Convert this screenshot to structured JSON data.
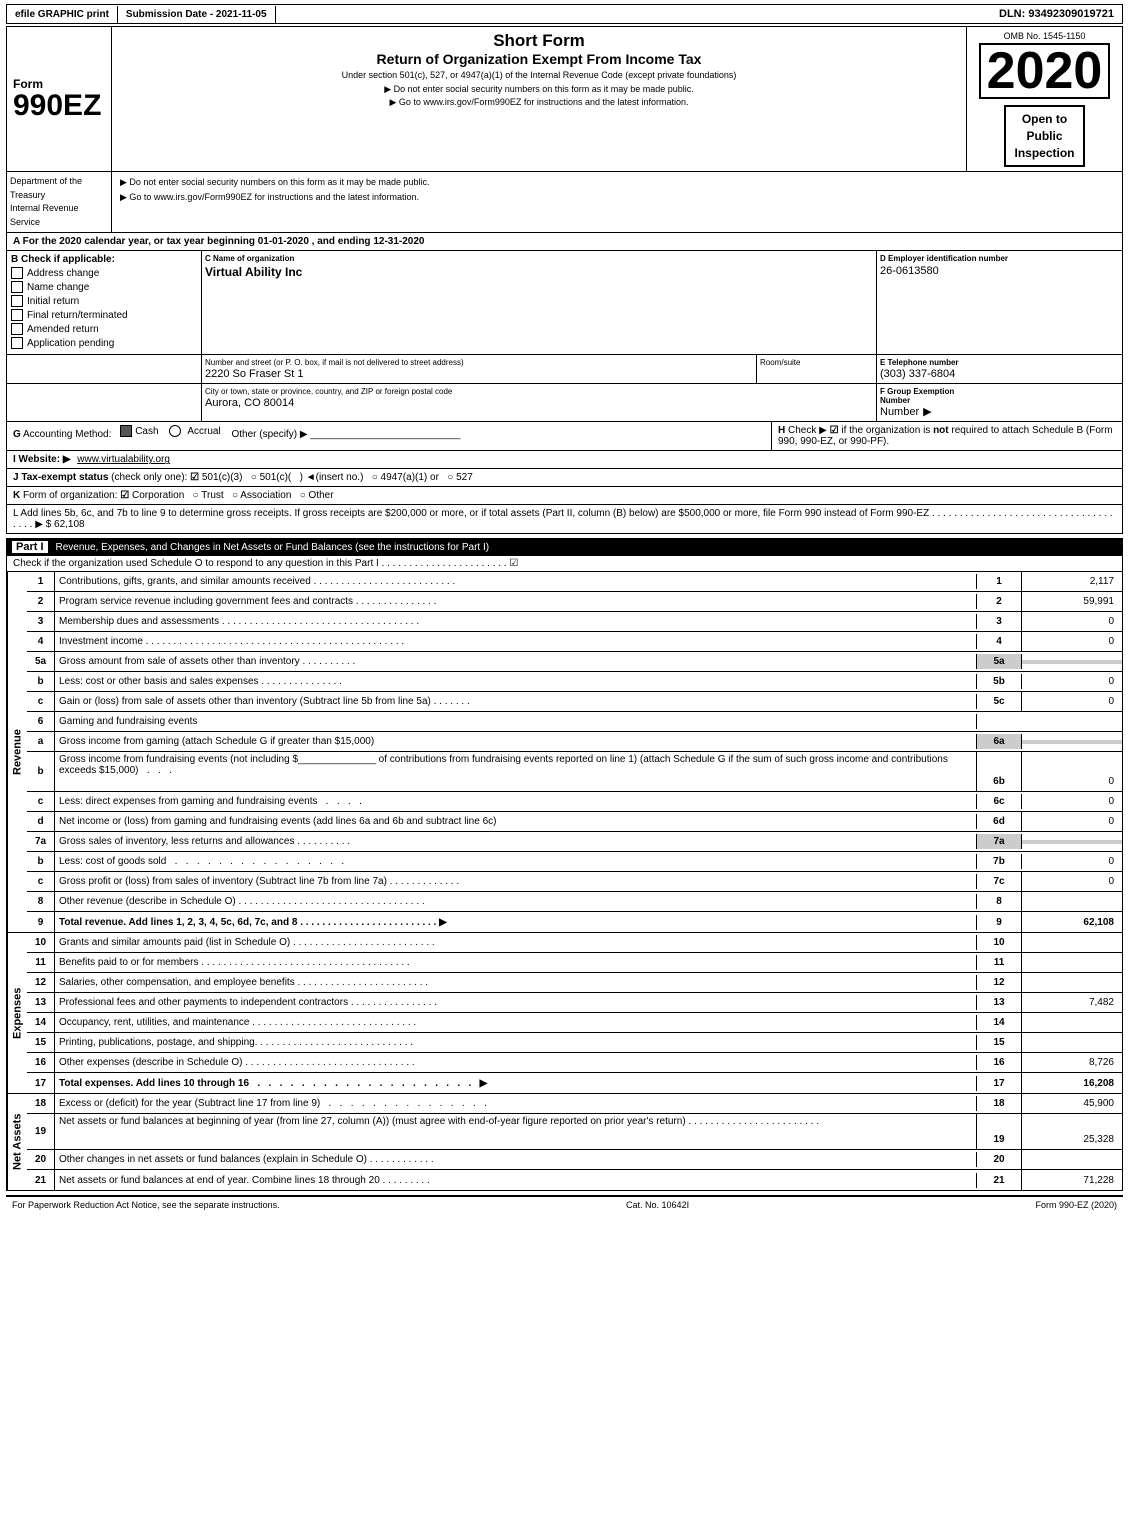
{
  "header": {
    "efile_label": "efile GRAPHIC print",
    "submission_label": "Submission Date - 2021-11-05",
    "dln_label": "DLN: 93492309019721",
    "form_number": "990EZ",
    "short_form": "Short Form",
    "return_title": "Return of Organization Exempt From Income Tax",
    "under_section": "Under section 501(c), 527, or 4947(a)(1) of the Internal Revenue Code (except private foundations)",
    "ssn_warning": "▶ Do not enter social security numbers on this form as it may be made public.",
    "goto_text": "▶ Go to www.irs.gov/Form990EZ for instructions and the latest information.",
    "year": "2020",
    "omb": "OMB No. 1545-1150",
    "open_to_public": "Open to\nPublic\nInspection",
    "dept_line1": "Department of the",
    "dept_line2": "Treasury",
    "dept_line3": "Internal Revenue",
    "dept_line4": "Service"
  },
  "section_a": {
    "text": "A For the 2020 calendar year, or tax year beginning 01-01-2020 , and ending 12-31-2020"
  },
  "check_applicable": {
    "label": "B Check if applicable:",
    "items": [
      {
        "id": "address_change",
        "label": "Address change",
        "checked": false
      },
      {
        "id": "name_change",
        "label": "Name change",
        "checked": false
      },
      {
        "id": "initial_return",
        "label": "Initial return",
        "checked": false
      },
      {
        "id": "final_return",
        "label": "Final return/terminated",
        "checked": false
      },
      {
        "id": "amended_return",
        "label": "Amended return",
        "checked": false
      },
      {
        "id": "application_pending",
        "label": "Application pending",
        "checked": false
      }
    ]
  },
  "org": {
    "c_label": "C Name of organization",
    "c_value": "Virtual Ability Inc",
    "d_label": "D Employer identification number",
    "d_value": "26-0613580",
    "address_label": "Number and street (or P. O. box, if mail is not delivered to street address)",
    "address_value": "2220 So Fraser St 1",
    "room_label": "Room/suite",
    "room_value": "",
    "e_label": "E Telephone number",
    "e_value": "(303) 337-6804",
    "city_label": "City or town, state or province, country, and ZIP or foreign postal code",
    "city_value": "Aurora, CO  80014",
    "f_label": "F Group Exemption\nNumber",
    "f_value": ""
  },
  "g_section": {
    "label": "G Accounting Method:",
    "cash_checked": true,
    "accrual_checked": false,
    "other_label": "Other (specify) ▶",
    "other_value": ""
  },
  "h_section": {
    "text": "H Check ▶ ☑ if the organization is not required to attach Schedule B (Form 990, 990-EZ, or 990-PF)."
  },
  "i_section": {
    "label": "I Website: ▶",
    "value": "www.virtualability.org"
  },
  "j_section": {
    "text": "J Tax-exempt status (check only one): ☑ 501(c)(3)  ○ 501(c)(   )◄(insert no.)  ○ 4947(a)(1) or  ○ 527"
  },
  "k_section": {
    "text": "K Form of organization: ☑ Corporation  ○ Trust  ○ Association  ○ Other"
  },
  "l_section": {
    "text": "L Add lines 5b, 6c, and 7b to line 9 to determine gross receipts. If gross receipts are $200,000 or more, or if total assets (Part II, column (B) below) are $500,000 or more, file Form 990 instead of Form 990-EZ . . . . . . . . . . . . . . . . . . . . . . . . . . . . . . . . . . . . . ▶ $ 62,108"
  },
  "part1": {
    "label": "Part I",
    "title": "Revenue, Expenses, and Changes in Net Assets or Fund Balances",
    "see_instructions": "(see the instructions for Part I)",
    "schedule_o_check": "Check if the organization used Schedule O to respond to any question in this Part I . . . . . . . . . . . . . . . . . . . . . . . ☑",
    "revenue_label": "Revenue",
    "expenses_label": "Expenses",
    "net_assets_label": "Net Assets",
    "lines": [
      {
        "num": "1",
        "desc": "Contributions, gifts, grants, and similar amounts received . . . . . . . . . . . . . . . . . . . . . . . . . .",
        "line_ref": "1",
        "amount": "2,117",
        "shaded": false
      },
      {
        "num": "2",
        "desc": "Program service revenue including government fees and contracts . . . . . . . . . . . . . . .",
        "line_ref": "2",
        "amount": "59,991",
        "shaded": false
      },
      {
        "num": "3",
        "desc": "Membership dues and assessments . . . . . . . . . . . . . . . . . . . . . . . . . . . . . . . . . . . .",
        "line_ref": "3",
        "amount": "0",
        "shaded": false
      },
      {
        "num": "4",
        "desc": "Investment income . . . . . . . . . . . . . . . . . . . . . . . . . . . . . . . . . . . . . . . . . . . . . . .",
        "line_ref": "4",
        "amount": "0",
        "shaded": false
      },
      {
        "num": "5a",
        "desc": "Gross amount from sale of assets other than inventory . . . . . . . . . .",
        "line_ref": "5a",
        "amount": "",
        "shaded": true,
        "sub": true
      },
      {
        "num": "b",
        "desc": "Less: cost or other basis and sales expenses . . . . . . . . . . . . . . .",
        "line_ref": "5b",
        "amount": "0",
        "shaded": false,
        "sub": true
      },
      {
        "num": "c",
        "desc": "Gain or (loss) from sale of assets other than inventory (Subtract line 5b from line 5a) . . . . . . .",
        "line_ref": "5c",
        "amount": "0",
        "shaded": false
      },
      {
        "num": "6",
        "desc": "Gaming and fundraising events",
        "line_ref": "",
        "amount": "",
        "shaded": false,
        "header": true
      },
      {
        "num": "a",
        "desc": "Gross income from gaming (attach Schedule G if greater than $15,000)",
        "line_ref": "6a",
        "amount": "",
        "shaded": true,
        "sub": true
      },
      {
        "num": "b",
        "desc": "Gross income from fundraising events (not including $_______________of contributions from fundraising events reported on line 1) (attach Schedule G if the sum of such gross income and contributions exceeds $15,000)    .    .",
        "line_ref": "6b",
        "amount": "0",
        "shaded": false,
        "sub": true
      },
      {
        "num": "c",
        "desc": "Less: direct expenses from gaming and fundraising events    .    .    .    .",
        "line_ref": "6c",
        "amount": "0",
        "shaded": false,
        "sub": true
      },
      {
        "num": "d",
        "desc": "Net income or (loss) from gaming and fundraising events (add lines 6a and 6b and subtract line 6c)",
        "line_ref": "6d",
        "amount": "0",
        "shaded": false
      },
      {
        "num": "7a",
        "desc": "Gross sales of inventory, less returns and allowances . . . . . . . . . .",
        "line_ref": "7a",
        "amount": "",
        "shaded": true,
        "sub": true
      },
      {
        "num": "b",
        "desc": "Less: cost of goods sold    .    .    .    .    .    .    .    .    .    .    .    .    .    .    .    .",
        "line_ref": "7b",
        "amount": "0",
        "shaded": false,
        "sub": true
      },
      {
        "num": "c",
        "desc": "Gross profit or (loss) from sales of inventory (Subtract line 7b from line 7a) . . . . . . . . . . . . .",
        "line_ref": "7c",
        "amount": "0",
        "shaded": false
      },
      {
        "num": "8",
        "desc": "Other revenue (describe in Schedule O) . . . . . . . . . . . . . . . . . . . . . . . . . . . . . . . . . .",
        "line_ref": "8",
        "amount": "",
        "shaded": false
      },
      {
        "num": "9",
        "desc": "Total revenue. Add lines 1, 2, 3, 4, 5c, 6d, 7c, and 8 . . . . . . . . . . . . . . . . . . . . . . . . . ▶",
        "line_ref": "9",
        "amount": "62,108",
        "shaded": false,
        "bold": true
      }
    ],
    "expense_lines": [
      {
        "num": "10",
        "desc": "Grants and similar amounts paid (list in Schedule O) . . . . . . . . . . . . . . . . . . . . . . . . . .",
        "line_ref": "10",
        "amount": ""
      },
      {
        "num": "11",
        "desc": "Benefits paid to or for members . . . . . . . . . . . . . . . . . . . . . . . . . . . . . . . . . . . . . .",
        "line_ref": "11",
        "amount": ""
      },
      {
        "num": "12",
        "desc": "Salaries, other compensation, and employee benefits . . . . . . . . . . . . . . . . . . . . . . . .",
        "line_ref": "12",
        "amount": ""
      },
      {
        "num": "13",
        "desc": "Professional fees and other payments to independent contractors . . . . . . . . . . . . . . . .",
        "line_ref": "13",
        "amount": "7,482"
      },
      {
        "num": "14",
        "desc": "Occupancy, rent, utilities, and maintenance . . . . . . . . . . . . . . . . . . . . . . . . . . . . . .",
        "line_ref": "14",
        "amount": ""
      },
      {
        "num": "15",
        "desc": "Printing, publications, postage, and shipping. . . . . . . . . . . . . . . . . . . . . . . . . . . . .",
        "line_ref": "15",
        "amount": ""
      },
      {
        "num": "16",
        "desc": "Other expenses (describe in Schedule O) . . . . . . . . . . . . . . . . . . . . . . . . . . . . . . .",
        "line_ref": "16",
        "amount": "8,726"
      },
      {
        "num": "17",
        "desc": "Total expenses. Add lines 10 through 16    .    .    .    .    .    .    .    .    .    .    .    .    .    .    .    .    .    .    .    .    ▶",
        "line_ref": "17",
        "amount": "16,208",
        "bold": true
      }
    ],
    "net_asset_lines": [
      {
        "num": "18",
        "desc": "Excess or (deficit) for the year (Subtract line 17 from line 9)    .    .    .    .    .    .    .    .    .    .    .    .    .    .    .    .",
        "line_ref": "18",
        "amount": "45,900"
      },
      {
        "num": "19",
        "desc": "Net assets or fund balances at beginning of year (from line 27, column (A)) (must agree with end-of-year figure reported on prior year's return)  . . . . . . . . . . . . . . . . . . . . . . . .",
        "line_ref": "19",
        "amount": "25,328"
      },
      {
        "num": "20",
        "desc": "Other changes in net assets or fund balances (explain in Schedule O) . . . . . . . . . . . .",
        "line_ref": "20",
        "amount": ""
      },
      {
        "num": "21",
        "desc": "Net assets or fund balances at end of year. Combine lines 18 through 20 . . . . . . . . .",
        "line_ref": "21",
        "amount": "71,228"
      }
    ]
  },
  "footer": {
    "paperwork_text": "For Paperwork Reduction Act Notice, see the separate instructions.",
    "cat_no": "Cat. No. 10642I",
    "form_ref": "Form 990-EZ (2020)"
  }
}
